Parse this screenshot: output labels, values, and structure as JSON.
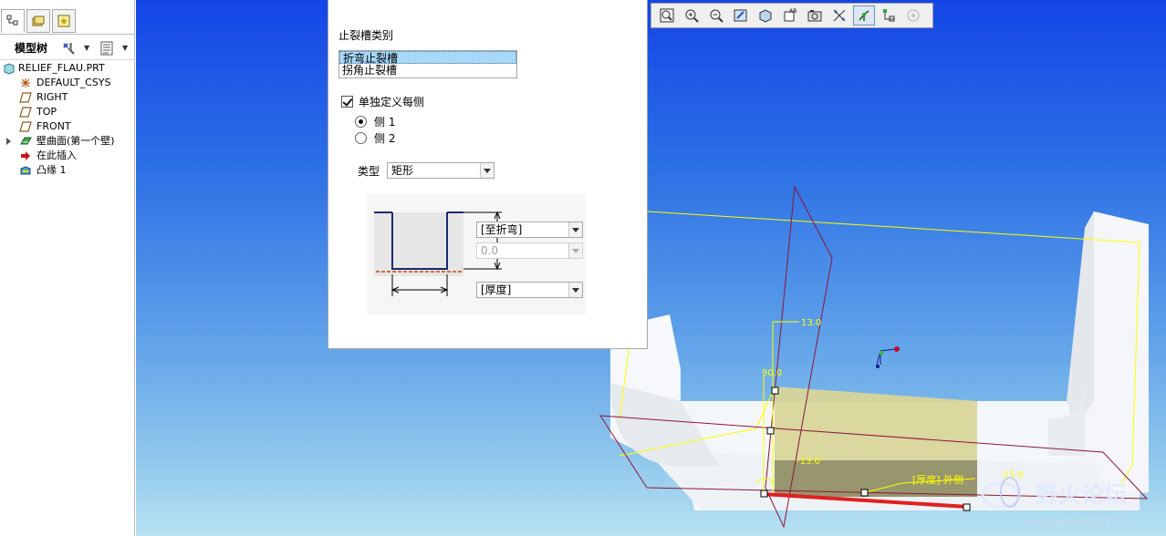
{
  "model_tree": {
    "title": "模型树",
    "items": [
      {
        "label": "RELIEF_FLAU.PRT",
        "icon": "part-icon"
      },
      {
        "label": "DEFAULT_CSYS",
        "icon": "csys-icon"
      },
      {
        "label": "RIGHT",
        "icon": "datum-plane-icon"
      },
      {
        "label": "TOP",
        "icon": "datum-plane-icon"
      },
      {
        "label": "FRONT",
        "icon": "datum-plane-icon"
      },
      {
        "label": "壁曲面(第一个壁)",
        "icon": "sheetmetal-wall-icon"
      },
      {
        "label": "在此插入",
        "icon": "insert-here-arrow-icon"
      },
      {
        "label": "凸缘 1",
        "icon": "flange-icon"
      }
    ]
  },
  "dialog": {
    "relief_category_label": "止裂槽类别",
    "relief_options": [
      "折弯止裂槽",
      "拐角止裂槽"
    ],
    "selected_option": "折弯止裂槽",
    "define_each_side_label": "单独定义每侧",
    "define_each_side_checked": true,
    "side_1_label": "侧 1",
    "side_2_label": "侧 2",
    "selected_side": "侧 1",
    "type_label": "类型",
    "type_value": "矩形",
    "depth_value": "[至折弯]",
    "depth_number": "0.0",
    "width_value": "[厚度]"
  },
  "toolbar": {
    "buttons": [
      "refit-icon",
      "zoom-in-icon",
      "zoom-out-icon",
      "repaint-icon",
      "spin-center-icon",
      "saved-views-icon",
      "named-view-icon",
      "annotation-display-icon",
      "datum-display-icon",
      "csys-display-icon",
      "spin-display-icon"
    ]
  },
  "viewport": {
    "dim_top": "13.0",
    "dim_angle": "90.0",
    "dim_left": "-13.0",
    "dim_right": "-15.0",
    "thickness_label": "[厚度] 外侧",
    "watermark_text": "野火论坛",
    "watermark_url": "www.proewildfire.cn"
  },
  "colors": {
    "background_top": "#1446e6",
    "background_bottom": "#b8e2f2",
    "selection_red": "#e02020",
    "datum_plane": "#8c1538",
    "sketch_yellow": "#ffff00",
    "relief_highlight": "#d8d59a"
  }
}
